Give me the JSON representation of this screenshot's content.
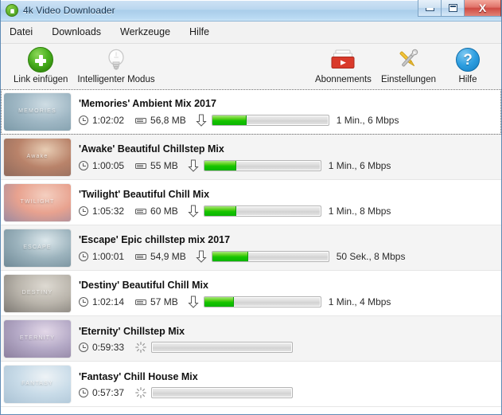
{
  "window": {
    "title": "4k Video Downloader",
    "app_icon": "app-logo-icon",
    "buttons": {
      "minimize": "minimize-button",
      "maximize": "maximize-button",
      "close": "X"
    }
  },
  "menubar": {
    "items": [
      {
        "label": "Datei"
      },
      {
        "label": "Downloads"
      },
      {
        "label": "Werkzeuge"
      },
      {
        "label": "Hilfe"
      }
    ]
  },
  "toolbar": {
    "left": [
      {
        "label": "Link einfügen",
        "icon": "add-circle-icon"
      },
      {
        "label": "Intelligenter Modus",
        "icon": "lightbulb-icon"
      }
    ],
    "right": [
      {
        "label": "Abonnements",
        "icon": "subscriptions-tray-icon"
      },
      {
        "label": "Einstellungen",
        "icon": "tools-icon"
      },
      {
        "label": "Hilfe",
        "icon": "help-circle-icon",
        "glyph": "?"
      }
    ]
  },
  "colors": {
    "progress_green": "#16c400",
    "titlebar_blue": "#a9cdea",
    "close_red": "#cf4b43",
    "accent_add": "#2f9208"
  },
  "downloads": [
    {
      "title": "'Memories' Ambient Mix 2017",
      "duration": "1:02:02",
      "size": "56,8 MB",
      "speed": "1 Min., 6 Mbps",
      "progress": 29,
      "state": "downloading",
      "thumb_label": "MEMORIES",
      "thumb_c1": "#9fb7c4",
      "thumb_c2": "#cfdde4",
      "thumb_c3": "#7c9aa8"
    },
    {
      "title": "'Awake' Beautiful Chillstep Mix",
      "duration": "1:00:05",
      "size": "55 MB",
      "speed": "1 Min., 6 Mbps",
      "progress": 27,
      "state": "downloading",
      "thumb_label": "Awake",
      "thumb_c1": "#b9836a",
      "thumb_c2": "#e8cdb4",
      "thumb_c3": "#8f6a5c"
    },
    {
      "title": "'Twilight' Beautiful Chill Mix",
      "duration": "1:05:32",
      "size": "60 MB",
      "speed": "1 Min., 8 Mbps",
      "progress": 27,
      "state": "downloading",
      "thumb_label": "TWILIGHT",
      "thumb_c1": "#e8a28f",
      "thumb_c2": "#f4cfc0",
      "thumb_c3": "#9d8aa0"
    },
    {
      "title": "'Escape' Epic chillstep mix 2017",
      "duration": "1:00:01",
      "size": "54,9 MB",
      "speed": "50 Sek., 8 Mbps",
      "progress": 30,
      "state": "downloading",
      "thumb_label": "ESCAPE",
      "thumb_c1": "#9cb3bd",
      "thumb_c2": "#dde8ec",
      "thumb_c3": "#6f8996"
    },
    {
      "title": "'Destiny' Beautiful Chill Mix",
      "duration": "1:02:14",
      "size": "57 MB",
      "speed": "1 Min., 4 Mbps",
      "progress": 25,
      "state": "downloading",
      "thumb_label": "DESTINY",
      "thumb_c1": "#b9b4ab",
      "thumb_c2": "#dedad2",
      "thumb_c3": "#7e7a74"
    },
    {
      "title": "'Eternity' Chillstep Mix",
      "duration": "0:59:33",
      "size": "",
      "speed": "",
      "progress": 0,
      "state": "pending",
      "thumb_label": "ETERNITY",
      "thumb_c1": "#b4a9c6",
      "thumb_c2": "#e3d8e8",
      "thumb_c3": "#8c7f9e"
    },
    {
      "title": "'Fantasy' Chill House Mix",
      "duration": "0:57:37",
      "size": "",
      "speed": "",
      "progress": 0,
      "state": "pending",
      "thumb_label": "FANTASY",
      "thumb_c1": "#c8dbe8",
      "thumb_c2": "#eef3f6",
      "thumb_c3": "#aac2d4"
    }
  ]
}
